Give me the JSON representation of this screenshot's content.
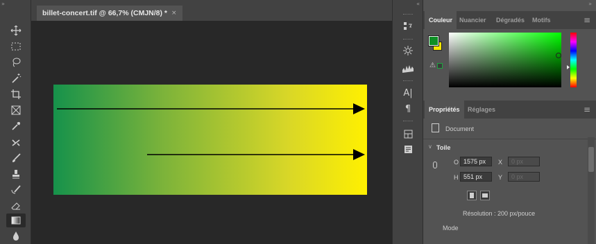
{
  "document": {
    "tab_title": "billet-concert.tif @ 66,7% (CMJN/8) *",
    "close_glyph": "×"
  },
  "canvas": {
    "gradient_colors": [
      "#16924b",
      "#7cb33a",
      "#d9d727",
      "#fff000"
    ]
  },
  "tools": [
    "move-icon",
    "marquee-icon",
    "lasso-icon",
    "magic-wand-icon",
    "crop-icon",
    "frame-icon",
    "eyedropper-icon",
    "healing-icon",
    "brush-icon",
    "clone-stamp-icon",
    "history-brush-icon",
    "eraser-icon",
    "gradient-icon",
    "blur-icon"
  ],
  "middle_panel_icons": [
    "panel-swatch-icon",
    "settings-icon",
    "histogram-icon",
    "character-icon",
    "paragraph-icon",
    "layers-icon",
    "notes-icon"
  ],
  "color_panel": {
    "tabs": [
      "Couleur",
      "Nuancier",
      "Dégradés",
      "Motifs"
    ],
    "foreground": "#0d8f25",
    "background": "#f5e600",
    "warning_icon": "⚠"
  },
  "properties_panel": {
    "tabs": [
      "Propriétés",
      "Réglages"
    ],
    "document_label": "Document",
    "section_title": "Toile",
    "width_label": "O",
    "width_value": "1575 px",
    "height_label": "H",
    "height_value": "551 px",
    "x_label": "X",
    "x_value": "0 px",
    "y_label": "Y",
    "y_value": "0 px",
    "resolution": "Résolution : 200 px/pouce",
    "mode_label": "Mode"
  },
  "collapse_glyphs": {
    "left": "»",
    "middle": "«",
    "right": "»"
  },
  "menu_glyph": "≡"
}
